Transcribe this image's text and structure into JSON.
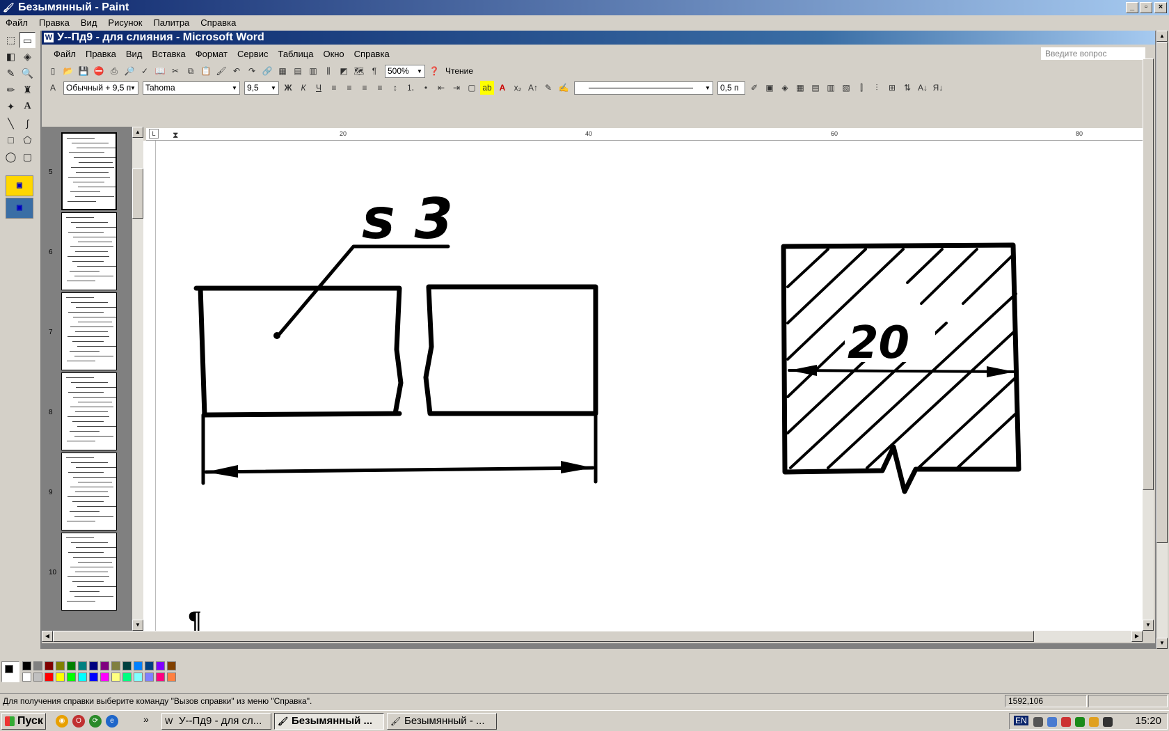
{
  "paint": {
    "title": "Безымянный - Paint",
    "menu": [
      "Файл",
      "Правка",
      "Вид",
      "Рисунок",
      "Палитра",
      "Справка"
    ],
    "status_text": "Для получения справки выберите команду \"Вызов справки\" из меню \"Справка\".",
    "coords": "1592,106"
  },
  "word": {
    "title": "У--Пд9 - для слияния - Microsoft Word",
    "menu": [
      "Файл",
      "Правка",
      "Вид",
      "Вставка",
      "Формат",
      "Сервис",
      "Таблица",
      "Окно",
      "Справка"
    ],
    "ask_placeholder": "Введите вопрос",
    "zoom": "500%",
    "reading_button": "Чтение",
    "style": "Обычный + 9,5 п",
    "font": "Tahoma",
    "font_size": "9,5",
    "bold": "Ж",
    "italic": "К",
    "underline": "Ч",
    "line_weight": "0,5 п",
    "ruler_marks": [
      "20",
      "40",
      "60",
      "80"
    ],
    "thumb_numbers": [
      "5",
      "6",
      "7",
      "8",
      "9",
      "10"
    ],
    "drawing": {
      "label_left": "s 3",
      "label_right": "20"
    },
    "pilcrow": "¶"
  },
  "taskbar": {
    "start": "Пуск",
    "tasks": [
      "У--Пд9 - для сл...",
      "Безымянный ...",
      "Безымянный - ..."
    ],
    "lang": "EN",
    "clock": "15:20"
  }
}
